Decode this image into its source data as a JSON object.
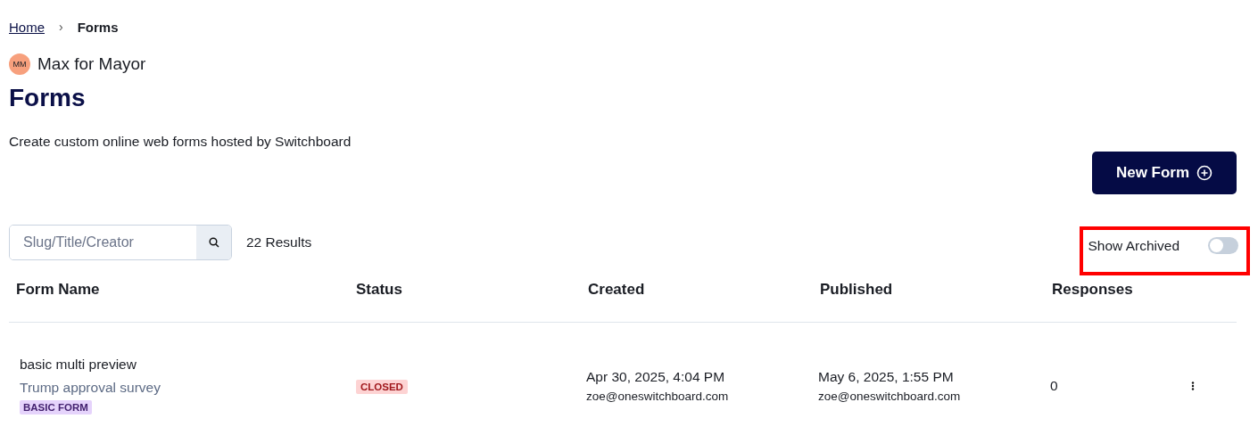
{
  "breadcrumb": [
    {
      "label": "Home",
      "kind": "link"
    },
    {
      "label": "Forms",
      "kind": "current"
    }
  ],
  "breadcrumb_separator": "›",
  "organization": {
    "initials": "MM",
    "name": "Max for Mayor"
  },
  "title": "Forms",
  "description": "Create custom online web forms hosted by Switchboard",
  "new_form_button": "New Form",
  "search": {
    "placeholder": "Slug/Title/Creator"
  },
  "result_count": "22 Results",
  "show_archived": {
    "label": "Show Archived",
    "on": false,
    "highlighted": true
  },
  "table": {
    "columns": [
      "Form Name",
      "Status",
      "Created",
      "Published",
      "Responses"
    ],
    "rows": [
      {
        "name": "basic multi preview",
        "title": "Trump approval survey",
        "tag": "BASIC FORM",
        "status": {
          "label": "CLOSED",
          "kind": "closed"
        },
        "created": "Apr 30, 2025, 4:04 PM",
        "created_by": "zoe@oneswitchboard.com",
        "published": "May 6, 2025, 1:55 PM",
        "published_by": "zoe@oneswitchboard.com",
        "responses": "0"
      }
    ]
  }
}
